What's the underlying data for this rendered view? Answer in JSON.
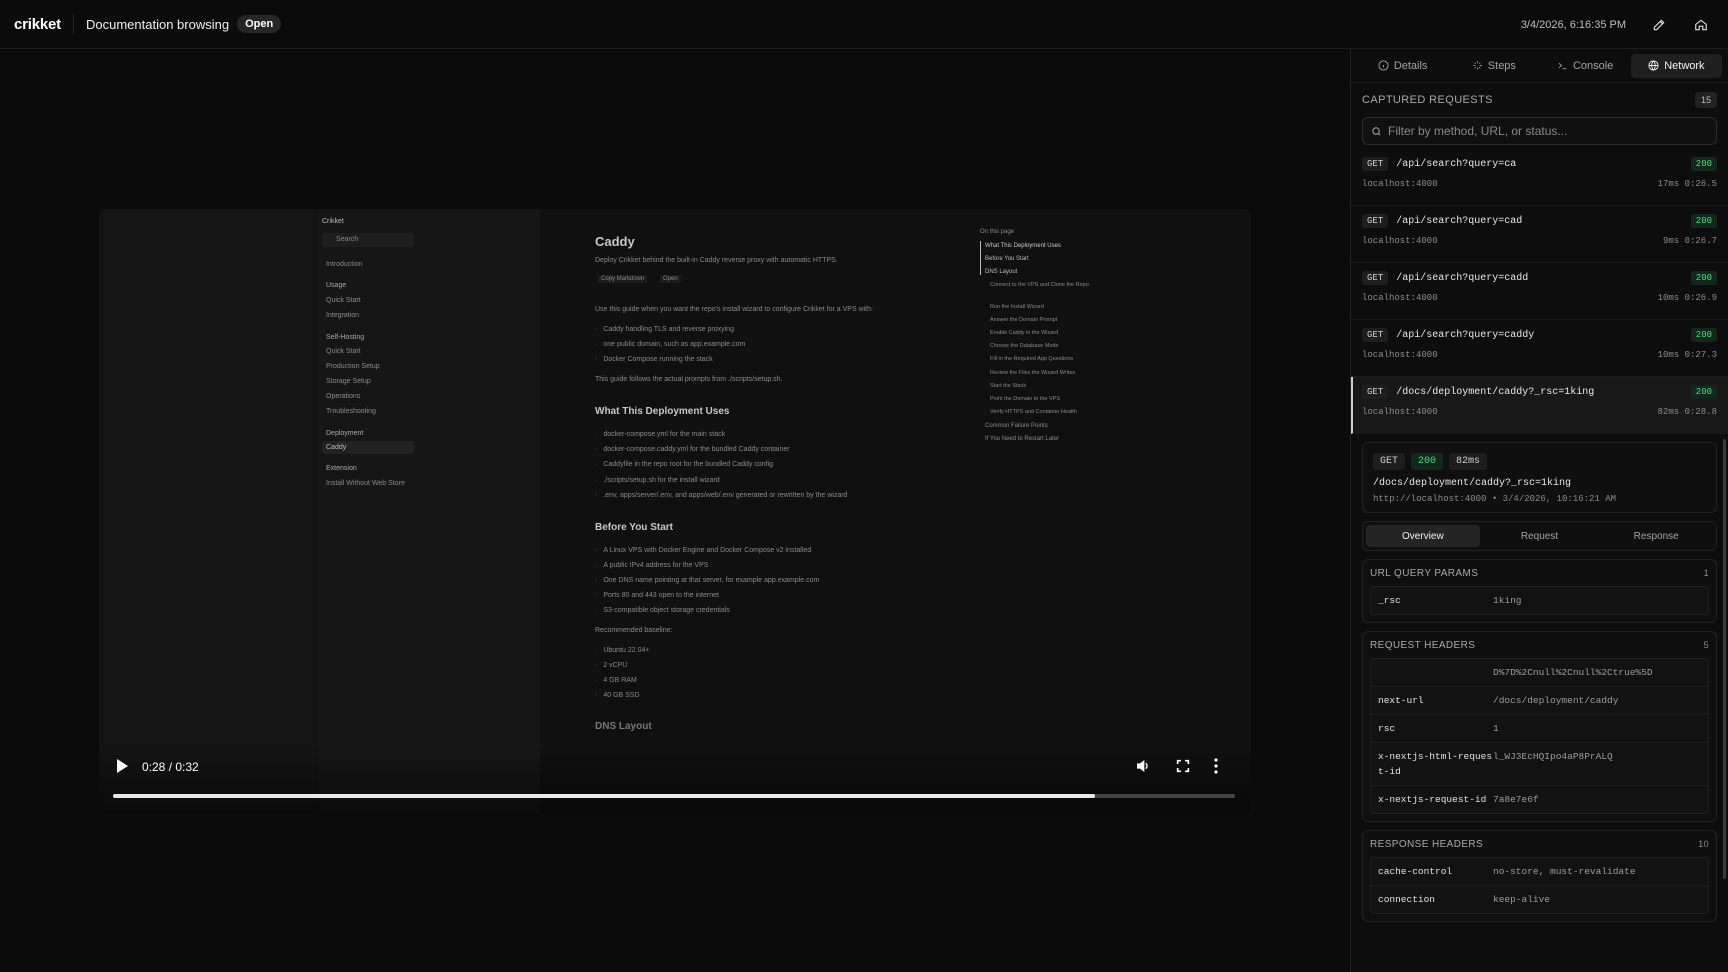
{
  "header": {
    "brand": "crikket",
    "title": "Documentation browsing",
    "status": "Open",
    "timestamp": "3/4/2026, 6:16:35 PM"
  },
  "video": {
    "time": "0:28 / 0:32",
    "progress": 0.875,
    "recorded_page": {
      "sidebar": {
        "brand": "Crikket",
        "search_placeholder": "Search",
        "items": [
          "Introduction",
          "Usage",
          "Quick Start",
          "Integration",
          "Self-Hosting",
          "Quick Start",
          "Production Setup",
          "Storage Setup",
          "Operations",
          "Troubleshooting",
          "Deployment",
          "Caddy",
          "Extension",
          "Install Without Web Store"
        ]
      },
      "title": "Caddy",
      "subtitle": "Deploy Crikket behind the built-in Caddy reverse proxy with automatic HTTPS.",
      "copy_markdown": "Copy Markdown",
      "open": "Open",
      "intro": "Use this guide when you want the repo's install wizard to configure Crikket for a VPS with:",
      "intro_bullets": [
        "Caddy handling TLS and reverse proxying",
        "one public domain, such as app.example.com",
        "Docker Compose running the stack"
      ],
      "guide_note": "This guide follows the actual prompts from ./scripts/setup.sh.",
      "h_uses": "What This Deployment Uses",
      "uses_bullets": [
        "docker-compose.yml for the main stack",
        "docker-compose.caddy.yml for the bundled Caddy container",
        "Caddyfile in the repo root for the bundled Caddy config",
        "./scripts/setup.sh for the install wizard",
        ".env, apps/server/.env, and apps/web/.env generated or rewritten by the wizard"
      ],
      "h_before": "Before You Start",
      "before_bullets": [
        "A Linux VPS with Docker Engine and Docker Compose v2 installed",
        "A public IPv4 address for the VPS",
        "One DNS name pointing at that server, for example app.example.com",
        "Ports 80 and 443 open to the internet",
        "S3-compatible object storage credentials"
      ],
      "baseline_label": "Recommended baseline:",
      "baseline": [
        "Ubuntu 22.04+",
        "2 vCPU",
        "4 GB RAM",
        "40 GB SSD"
      ],
      "h_dns": "DNS Layout",
      "toc_title": "On this page",
      "toc": [
        "What This Deployment Uses",
        "Before You Start",
        "DNS Layout",
        "Connect to the VPS and Clone the Repo",
        "Run the Install Wizard",
        "Answer the Domain Prompt",
        "Enable Caddy in the Wizard",
        "Choose the Database Mode",
        "Fill in the Required App Questions",
        "Review the Files the Wizard Writes",
        "Start the Stack",
        "Point the Domain to the VPS",
        "Verify HTTPS and Container Health",
        "Common Failure Points",
        "If You Need to Restart Later"
      ]
    }
  },
  "panel": {
    "tabs": [
      {
        "label": "Details",
        "icon": "info-icon"
      },
      {
        "label": "Steps",
        "icon": "sparkle-icon"
      },
      {
        "label": "Console",
        "icon": "terminal-icon"
      },
      {
        "label": "Network",
        "icon": "globe-icon"
      }
    ],
    "captured_label": "CAPTURED REQUESTS",
    "captured_count": "15",
    "filter_placeholder": "Filter by method, URL, or status...",
    "requests": [
      {
        "method": "GET",
        "path": "/api/search?query=ca",
        "status": "200",
        "host": "localhost:4000",
        "timing": "17ms 0:26.5"
      },
      {
        "method": "GET",
        "path": "/api/search?query=cad",
        "status": "200",
        "host": "localhost:4000",
        "timing": "9ms 0:26.7"
      },
      {
        "method": "GET",
        "path": "/api/search?query=cadd",
        "status": "200",
        "host": "localhost:4000",
        "timing": "10ms 0:26.9"
      },
      {
        "method": "GET",
        "path": "/api/search?query=caddy",
        "status": "200",
        "host": "localhost:4000",
        "timing": "10ms 0:27.3"
      },
      {
        "method": "GET",
        "path": "/docs/deployment/caddy?_rsc=1king",
        "status": "200",
        "host": "localhost:4000",
        "timing": "82ms 0:28.8"
      }
    ],
    "detail": {
      "method": "GET",
      "status": "200",
      "duration": "82ms",
      "path": "/docs/deployment/caddy?_rsc=1king",
      "meta": "http://localhost:4000 • 3/4/2026, 10:16:21 AM"
    },
    "subtabs": [
      "Overview",
      "Request",
      "Response"
    ],
    "query_params": {
      "label": "URL QUERY PARAMS",
      "count": "1",
      "rows": [
        {
          "key": "_rsc",
          "value": "1king"
        }
      ]
    },
    "request_headers": {
      "label": "REQUEST HEADERS",
      "count": "5",
      "rows": [
        {
          "key": "",
          "value": "D%7D%2Cnull%2Cnull%2Ctrue%5D"
        },
        {
          "key": "next-url",
          "value": "/docs/deployment/caddy"
        },
        {
          "key": "rsc",
          "value": "1"
        },
        {
          "key": "x-nextjs-html-request-id",
          "value": "l_WJ3EcHQIpo4aP8PrALQ"
        },
        {
          "key": "x-nextjs-request-id",
          "value": "7a8e7e6f"
        }
      ]
    },
    "response_headers": {
      "label": "RESPONSE HEADERS",
      "count": "10",
      "rows": [
        {
          "key": "cache-control",
          "value": "no-store, must-revalidate"
        },
        {
          "key": "connection",
          "value": "keep-alive"
        }
      ]
    }
  }
}
